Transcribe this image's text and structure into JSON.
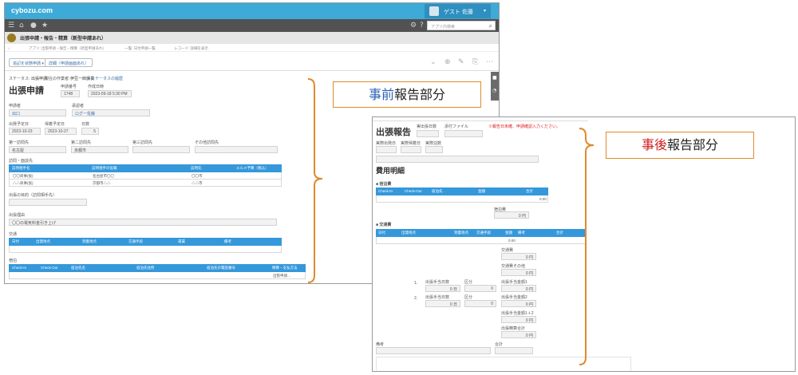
{
  "brand": "cybozu.com",
  "user_name": "ゲスト 佐藤",
  "search_placeholder": "アプリ内検索",
  "app_title": "出張申請・報告・精算（新型申請あれ）",
  "breadcrumbs": [
    "アプリ: 出張申請・報告・精算（新型申請あれ）",
    "一覧: 日付申請一覧",
    "レコード: 詳細を表示"
  ],
  "toolbar": {
    "btn1": "追記を状態申請 ▾",
    "btn2": "詳細（申請画面あれ）"
  },
  "status": {
    "label": "ステータス:",
    "value": "出張申請",
    "assignee_label": "現在の作業者:",
    "assignee": "伊豆一郎課長",
    "history_link": "ステータスの履歴"
  },
  "win1": {
    "page_title": "出張申請",
    "fields": {
      "app_no_label": "申請番号",
      "app_no": "1748",
      "created_label": "作成日時",
      "created": "2023-09-18 5:30 PM",
      "applicant_label": "申請者",
      "applicant": "出口",
      "approver_label": "承認者",
      "approver": "ログー佐藤",
      "start_label": "出発予定日",
      "start": "2023-10-23",
      "end_label": "帰着予定日",
      "end": "2023-10-27",
      "days_label": "日数",
      "days": "5",
      "dest1_label": "第一訪問先",
      "dest1": "名古屋",
      "dest2_label": "第二訪問先",
      "dest2": "京都市",
      "dest3_label": "第三訪問先",
      "dest4_label": "その他訪問先",
      "visits_label": "訪問・面談先",
      "purpose_label": "出張の目的（訪問相手先）",
      "reason_label": "出張理由",
      "reason": "〇〇の電気料金引き上げ",
      "transport_label": "交通",
      "lodging_label": "宿泊"
    },
    "visits_headers": [
      "訪問相手名",
      "訪問相手の役職",
      "訪問先",
      "エルメ予算（税込）"
    ],
    "visits_rows": [
      [
        "〇〇商事(仮)",
        "名古屋市〇〇",
        "〇〇市",
        ""
      ],
      [
        "△△商事(仮)",
        "京都市△△",
        "△△市",
        ""
      ]
    ],
    "transport_headers": [
      "日付",
      "出発地点",
      "到着地点",
      "交通手段",
      "運賃",
      "備考"
    ],
    "lodging_headers": [
      "Check-In",
      "Check-Out",
      "宿泊先名",
      "宿泊先住所",
      "宿泊先の電話番号",
      "精算・支払方法"
    ],
    "lodging_row_last": "出張申請…"
  },
  "label_pre": {
    "accent": "事前",
    "rest": "報告部分"
  },
  "label_post": {
    "accent": "事後",
    "rest": "報告部分"
  },
  "win2": {
    "title": "出張報告",
    "actual_days_label": "実出張日数",
    "file_label": "添付ファイル",
    "warning": "※報告日未確、申請確認入力ください。",
    "depart_label": "実際出発日",
    "return_label": "実際帰着日",
    "nights_label": "実際泊数",
    "expense_heading": "費用明細",
    "sec1_label": "■ 宿泊費",
    "sec1_headers": [
      "Check-In",
      "Check-Out",
      "宿泊先",
      "金額",
      "合計"
    ],
    "sec1_total": "0.00",
    "subtotal1_label": "宿泊費",
    "subtotal1": "0 円",
    "sec2_label": "■ 交通費",
    "sec2_headers": [
      "日付",
      "出発地点",
      "到着地点",
      "交通手段",
      "金額",
      "備考",
      "合計"
    ],
    "sec2_total": "0.00",
    "transport_total_label": "交通費",
    "transport_total": "0 円",
    "transport_other_label": "交通費その他",
    "transport_other": "0 円",
    "allowance_rows": [
      {
        "n": "1.",
        "a_label": "出張手当日数",
        "a": "0 日",
        "b_label": "区分",
        "b": "0",
        "c_label": "出張手当金額1",
        "c": "0 円"
      },
      {
        "n": "2.",
        "a_label": "出張手当日数",
        "a": "0 日",
        "b_label": "区分",
        "b": "0",
        "c_label": "出張手当金額2",
        "c": "0 円"
      }
    ],
    "allowance_sum_label": "出張手当金額1＋2",
    "allowance_sum": "0 円",
    "grand_total_label": "出張精算合計",
    "grand_total": "0 円",
    "memo_label": "備考",
    "other_label": "合計"
  }
}
